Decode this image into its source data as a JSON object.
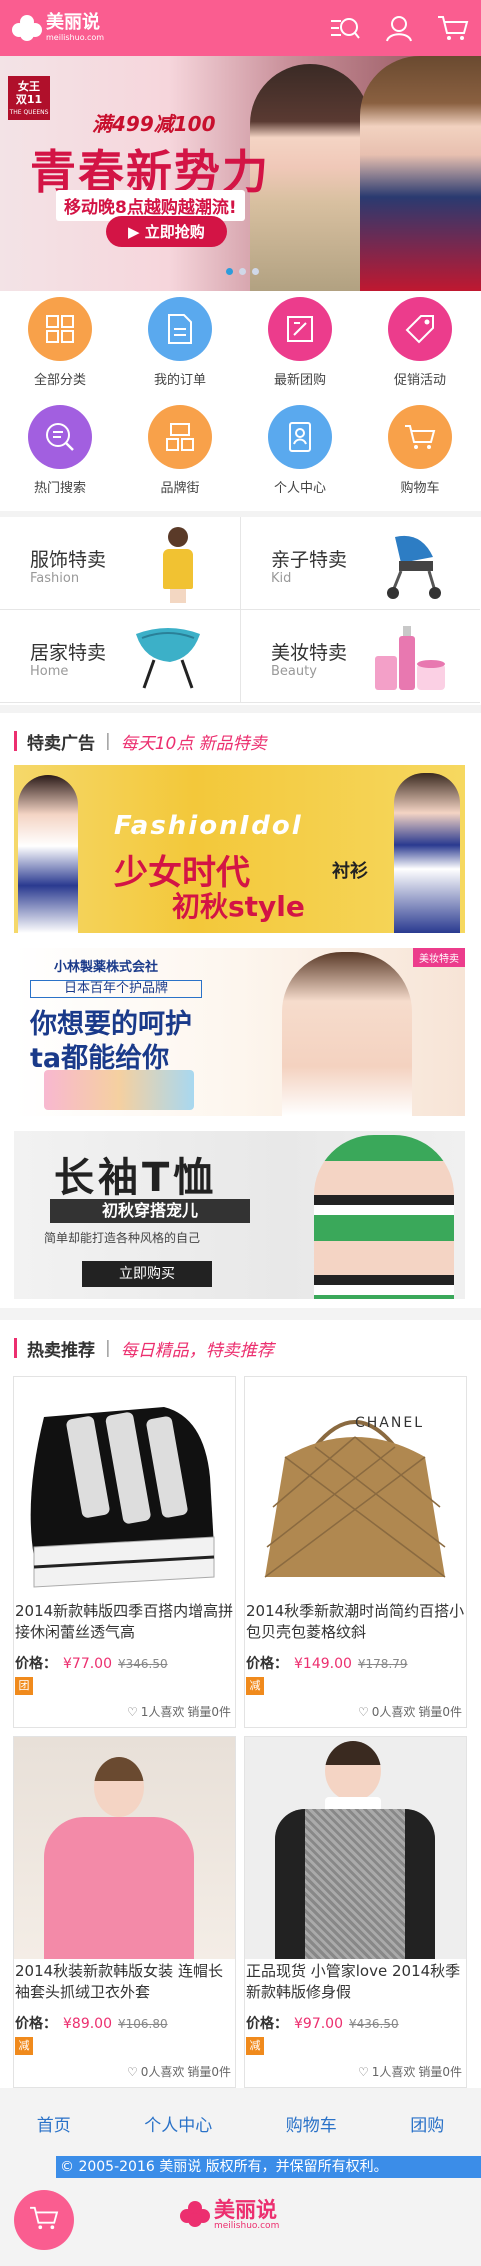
{
  "header": {
    "logo_cn": "美丽说",
    "logo_en": "meilishuo.com"
  },
  "hero": {
    "badge_line1": "女王",
    "badge_line2": "双11",
    "badge_small": "THE QUEENS",
    "promo": "满499减100",
    "headline": "青春新势力",
    "sub": "移动晚8点越购越潮流!",
    "cta": "▶ 立即抢购"
  },
  "icon_grid": [
    {
      "label": "全部分类",
      "color": "#f8a14a"
    },
    {
      "label": "我的订单",
      "color": "#5aa9ee"
    },
    {
      "label": "最新团购",
      "color": "#ec3c8c"
    },
    {
      "label": "促销活动",
      "color": "#ec3c8c"
    },
    {
      "label": "热门搜索",
      "color": "#a25fe0"
    },
    {
      "label": "品牌街",
      "color": "#f8a14a"
    },
    {
      "label": "个人中心",
      "color": "#5aa9ee"
    },
    {
      "label": "购物车",
      "color": "#f8a14a"
    }
  ],
  "categories": [
    {
      "title": "服饰特卖",
      "en": "Fashion"
    },
    {
      "title": "亲子特卖",
      "en": "Kid"
    },
    {
      "title": "居家特卖",
      "en": "Home"
    },
    {
      "title": "美妆特卖",
      "en": "Beauty"
    }
  ],
  "ads_section": {
    "name": "特卖广告",
    "sep": "|",
    "slogan": "每天10点 新品特卖"
  },
  "banners": [
    {
      "big": "少女时代",
      "sub": "初秋style",
      "script": "FashionIdol",
      "tag": "衬衫"
    },
    {
      "company": "小林製薬株式会社",
      "line1": "日本百年个护品牌",
      "line2": "你想要的呵护",
      "line3": "ta都能给你",
      "corner": "美妆特卖"
    },
    {
      "big": "长袖T恤",
      "sub": "初秋穿搭宠儿",
      "small": "简单却能打造各种风格的自己",
      "cta": "立即购买"
    }
  ],
  "hot_section": {
    "name": "热卖推荐",
    "sep": "|",
    "slogan": "每日精品，特卖推荐"
  },
  "products": [
    {
      "title": "2014新款韩版四季百搭内增高拼接休闲蕾丝透气高",
      "label": "价格：",
      "price": "¥77.00",
      "old": "¥346.50",
      "tag": "团",
      "likes": "1人喜欢",
      "sales": "销量0件"
    },
    {
      "title": "2014秋季新款潮时尚简约百搭小包贝壳包菱格纹斜",
      "label": "价格：",
      "price": "¥149.00",
      "old": "¥178.79",
      "tag": "减",
      "likes": "0人喜欢",
      "sales": "销量0件",
      "brand": "CHANEL"
    },
    {
      "title": "2014秋装新款韩版女装 连帽长袖套头抓绒卫衣外套",
      "label": "价格：",
      "price": "¥89.00",
      "old": "¥106.80",
      "tag": "减",
      "likes": "0人喜欢",
      "sales": "销量0件"
    },
    {
      "title": "正品现货 小管家love 2014秋季新款韩版修身假",
      "label": "价格：",
      "price": "¥97.00",
      "old": "¥436.50",
      "tag": "减",
      "likes": "1人喜欢",
      "sales": "销量0件"
    }
  ],
  "bottom_nav": [
    "首页",
    "个人中心",
    "购物车",
    "团购"
  ],
  "copyright": "© 2005-2016 美丽说 版权所有，并保留所有权利。",
  "footer": {
    "logo_cn": "美丽说",
    "logo_en": "meilishuo.com"
  }
}
